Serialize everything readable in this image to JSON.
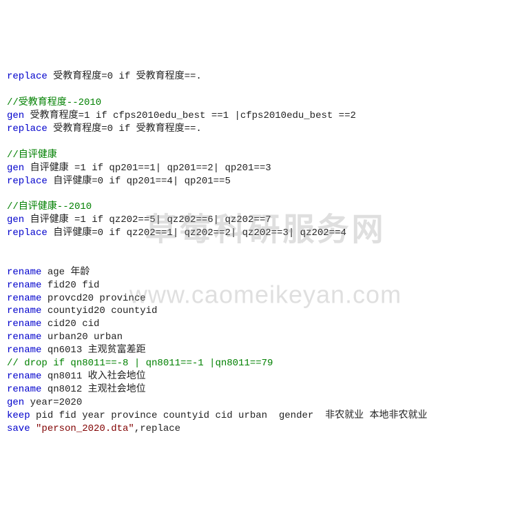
{
  "watermark": {
    "line1": "草莓科研服务网",
    "line2": "www.caomeikeyan.com"
  },
  "code": {
    "l01_kw": "replace",
    "l01_rest": " 受教育程度=0 if 受教育程度==.",
    "l03_cmt": "//受教育程度--2010",
    "l04_kw": "gen",
    "l04_rest": " 受教育程度=1 if cfps2010edu_best ==1 |cfps2010edu_best ==2",
    "l05_kw": "replace",
    "l05_rest": " 受教育程度=0 if 受教育程度==.",
    "l07_cmt": "//自评健康",
    "l08_kw": "gen",
    "l08_rest": " 自评健康 =1 if qp201==1| qp201==2| qp201==3",
    "l09_kw": "replace",
    "l09_rest": " 自评健康=0 if qp201==4| qp201==5",
    "l11_cmt": "//自评健康--2010",
    "l12_kw": "gen",
    "l12_rest": " 自评健康 =1 if qz202==5| qz202==6| qz202==7",
    "l13_kw": "replace",
    "l13_rest": " 自评健康=0 if qz202==1| qz202==2| qz202==3| qz202==4",
    "l16_kw": "rename",
    "l16_rest": " age 年龄",
    "l17_kw": "rename",
    "l17_rest": " fid20 fid",
    "l18_kw": "rename",
    "l18_rest": " provcd20 province",
    "l19_kw": "rename",
    "l19_rest": " countyid20 countyid",
    "l20_kw": "rename",
    "l20_rest": " cid20 cid",
    "l21_kw": "rename",
    "l21_rest": " urban20 urban",
    "l22_kw": "rename",
    "l22_rest": " qn6013 主观贫富差距",
    "l23_cmt": "// drop if qn8011==-8 | qn8011==-1 |qn8011==79",
    "l24_kw": "rename",
    "l24_rest": " qn8011 收入社会地位",
    "l25_kw": "rename",
    "l25_rest": " qn8012 主观社会地位",
    "l26_kw": "gen",
    "l26_rest": " year=2020",
    "l27_kw": "keep",
    "l27_rest": " pid fid year province countyid cid urban  gender  非农就业 本地非农就业",
    "l28_kw": "save",
    "l28_str": " \"person_2020.dta\"",
    "l28_rest": ",replace"
  }
}
